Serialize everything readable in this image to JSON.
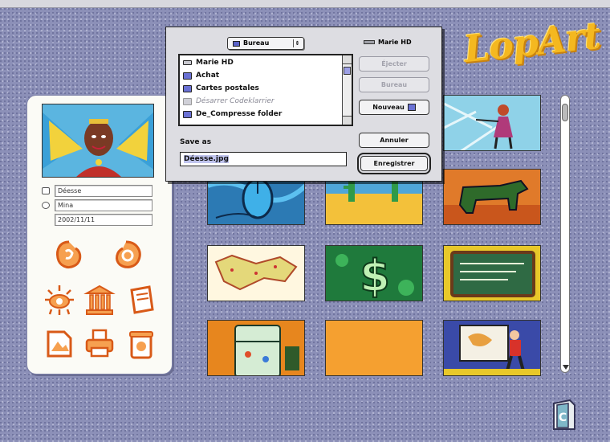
{
  "app": {
    "logo_text": "LopArt"
  },
  "dialog": {
    "folder_popup": "Bureau",
    "disk_name": "Marie HD",
    "files": [
      {
        "label": "Marie HD",
        "kind": "disk",
        "enabled": true
      },
      {
        "label": "Achat",
        "kind": "folder",
        "enabled": true
      },
      {
        "label": "Cartes postales",
        "kind": "folder",
        "enabled": true
      },
      {
        "label": "Désarrer Codeklarrier",
        "kind": "app",
        "enabled": false
      },
      {
        "label": "De_Compresse folder",
        "kind": "folder",
        "enabled": true
      }
    ],
    "buttons": {
      "eject": "Éjecter",
      "desktop": "Bureau",
      "new_folder": "Nouveau",
      "cancel": "Annuler",
      "save": "Enregistrer"
    },
    "save_as_label": "Save as",
    "filename": "Déesse.jpg"
  },
  "left_panel": {
    "fields": [
      "Déesse",
      "Mina",
      "2002/11/11"
    ]
  },
  "colors": {
    "background": "#8c90b8",
    "logo": "#f4b820",
    "tool_orange": "#f07a2a",
    "dialog_bg": "#dddde2"
  }
}
